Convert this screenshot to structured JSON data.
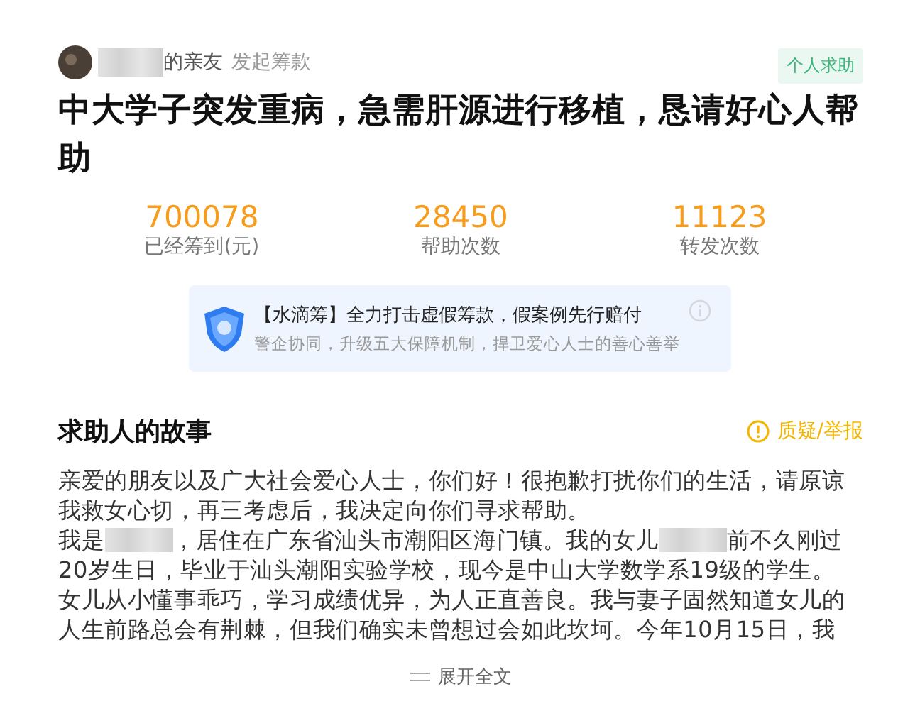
{
  "organizer": {
    "name_suffix": "的亲友",
    "action": "发起筹款"
  },
  "tag": "个人求助",
  "title": "中大学子突发重病，急需肝源进行移植，恳请好心人帮助",
  "stats": [
    {
      "value": "700078",
      "label": "已经筹到(元)"
    },
    {
      "value": "28450",
      "label": "帮助次数"
    },
    {
      "value": "11123",
      "label": "转发次数"
    }
  ],
  "notice": {
    "headline": "【水滴筹】全力打击虚假筹款，假案例先行赔付",
    "subtext": "警企协同，升级五大保障机制，捍卫爱心人士的善心善举"
  },
  "story": {
    "heading": "求助人的故事",
    "report_link": "质疑/举报",
    "lines": [
      [
        {
          "kind": "text",
          "text": "亲爱的朋友以及广大社会爱心人士，你们好！很抱歉打扰你们的生活，请原谅"
        }
      ],
      [
        {
          "kind": "text",
          "text": "我救女心切，再三考虑后，我决定向你们寻求帮助。"
        }
      ],
      [
        {
          "kind": "text",
          "text": "我是"
        },
        {
          "kind": "redacted"
        },
        {
          "kind": "text",
          "text": "，居住在广东省汕头市潮阳区海门镇。我的女儿"
        },
        {
          "kind": "redacted"
        },
        {
          "kind": "text",
          "text": "前不久刚过"
        }
      ],
      [
        {
          "kind": "text",
          "text": "20岁生日，毕业于汕头潮阳实验学校，现今是中山大学数学系19级的学生。"
        }
      ],
      [
        {
          "kind": "text",
          "text": "女儿从小懂事乖巧，学习成绩优异，为人正直善良。我与妻子固然知道女儿的"
        }
      ],
      [
        {
          "kind": "text",
          "text": "人生前路总会有荆棘，但我们确实未曾想过会如此坎坷。今年10月15日，我"
        }
      ]
    ],
    "expand": "展开全文"
  }
}
